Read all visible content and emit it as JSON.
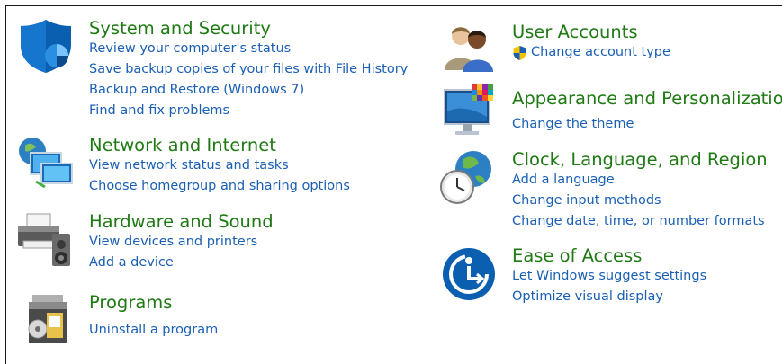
{
  "categories": [
    {
      "title": "System and Security",
      "icon": "shield-icon",
      "links": [
        "Review your computer's status",
        "Save backup copies of your files with File History",
        "Backup and Restore (Windows 7)",
        "Find and fix problems"
      ]
    },
    {
      "title": "Network and Internet",
      "icon": "network-globe-icon",
      "links": [
        "View network status and tasks",
        "Choose homegroup and sharing options"
      ]
    },
    {
      "title": "Hardware and Sound",
      "icon": "printer-speaker-icon",
      "links": [
        "View devices and printers",
        "Add a device"
      ]
    },
    {
      "title": "Programs",
      "icon": "programs-box-icon",
      "links": [
        "Uninstall a program"
      ]
    },
    {
      "title": "User Accounts",
      "icon": "users-icon",
      "links": [
        "Change account type"
      ]
    },
    {
      "title": "Appearance and Personalization",
      "icon": "monitor-palette-icon",
      "links": [
        "Change the theme"
      ]
    },
    {
      "title": "Clock, Language, and Region",
      "icon": "clock-globe-icon",
      "links": [
        "Add a language",
        "Change input methods",
        "Change date, time, or number formats"
      ]
    },
    {
      "title": "Ease of Access",
      "icon": "ease-of-access-icon",
      "links": [
        "Let Windows suggest settings",
        "Optimize visual display"
      ]
    }
  ],
  "colors": {
    "title": "#1f7a14",
    "link": "#1a5fb4"
  }
}
